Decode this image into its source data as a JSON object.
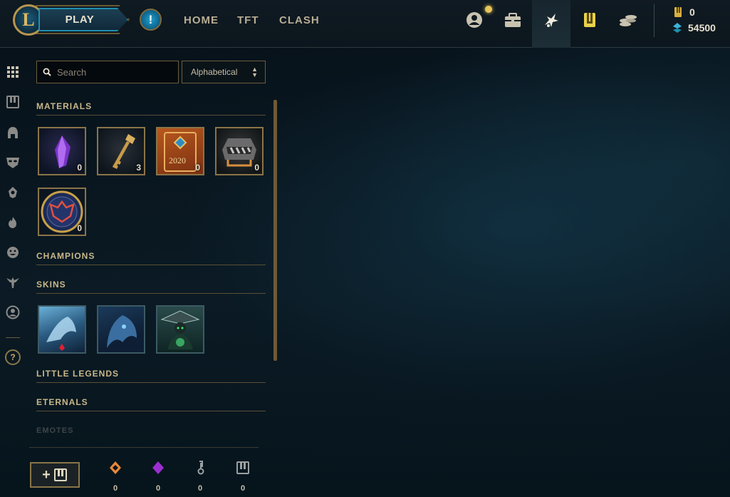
{
  "topbar": {
    "logo_letter": "L",
    "play_label": "PLAY",
    "alert_symbol": "!",
    "nav": [
      {
        "label": "HOME",
        "icon": "home"
      },
      {
        "label": "TFT",
        "icon": "tft"
      },
      {
        "label": "CLASH",
        "icon": "clash"
      }
    ],
    "icons": [
      "profile-icon",
      "collection-icon",
      "loot-icon",
      "hextech-icon",
      "store-icon"
    ],
    "currencies": {
      "rp": "0",
      "blue_essence": "54500"
    }
  },
  "rail": {
    "items": [
      "all-grid-icon",
      "chest-icon",
      "champion-helmet-icon",
      "mask-icon",
      "ward-icon",
      "fire-icon",
      "emote-face-icon",
      "little-legend-icon",
      "profile-circle-icon"
    ],
    "help_symbol": "?"
  },
  "panel": {
    "search_placeholder": "Search",
    "sort_value": "Alphabetical",
    "sections": {
      "materials": "MATERIALS",
      "champions": "CHAMPIONS",
      "skins": "SKINS",
      "little_legends": "LITTLE LEGENDS",
      "eternals": "ETERNALS",
      "emotes": "EMOTES"
    },
    "materials": [
      {
        "name": "mythic-essence",
        "count": "0"
      },
      {
        "name": "hextech-key",
        "count": "3"
      },
      {
        "name": "event-pass-2020",
        "count": "0"
      },
      {
        "name": "chest",
        "count": "0"
      },
      {
        "name": "worlds-emblem",
        "count": "0"
      }
    ],
    "materials_badge_text": "2020",
    "skins": [
      "skin-ice",
      "skin-dark-beast",
      "skin-green-mage"
    ]
  },
  "bottom": {
    "add_symbol": "+",
    "currencies": [
      {
        "name": "orange-essence",
        "value": "0",
        "color": "#e8883a"
      },
      {
        "name": "mythic-essence",
        "value": "0",
        "color": "#9a2fd0"
      },
      {
        "name": "key-fragment",
        "value": "0",
        "color": "#9aa0a2"
      },
      {
        "name": "chest",
        "value": "0",
        "color": "#9aa0a2"
      }
    ]
  },
  "colors": {
    "gold": "#c8aa6e",
    "accent_blue": "#1e8fb0",
    "background": "#0a1218"
  }
}
